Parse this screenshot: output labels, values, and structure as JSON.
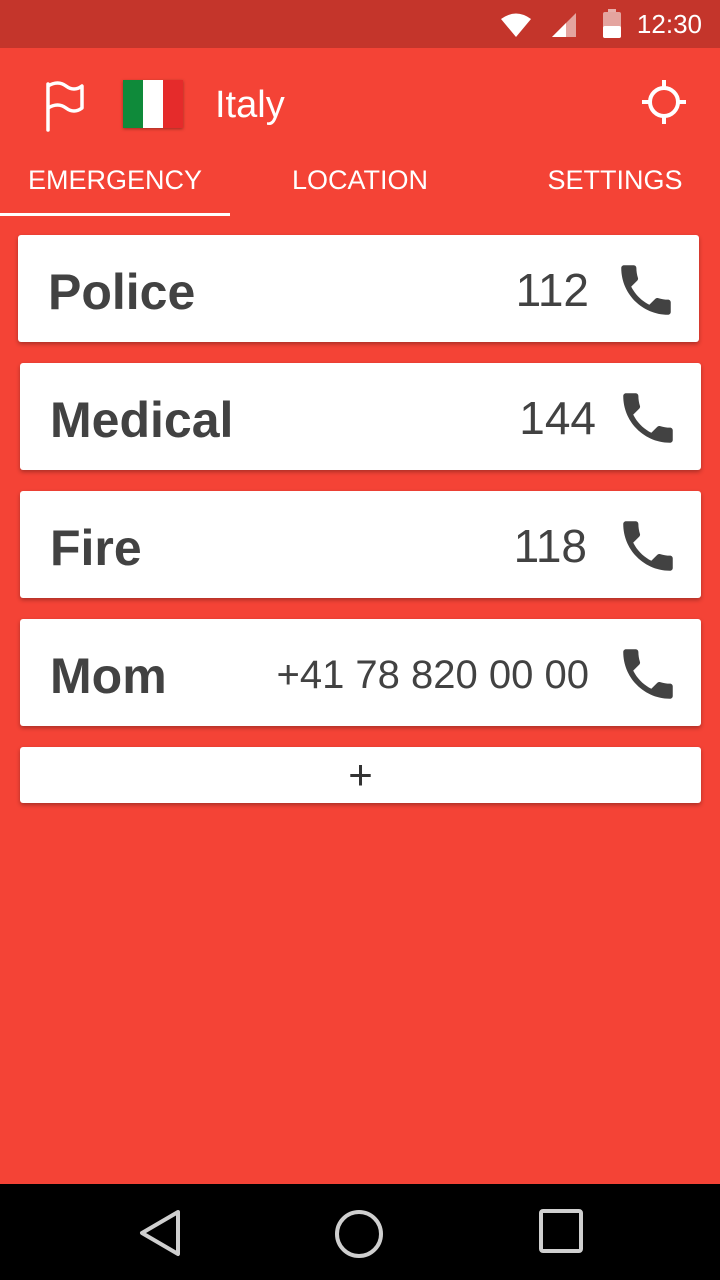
{
  "status_bar": {
    "time": "12:30",
    "icons": [
      "wifi-icon",
      "cell-signal-icon",
      "battery-icon"
    ]
  },
  "app_bar": {
    "country": "Italy",
    "flag_colors": [
      "#0f8a3a",
      "#ffffff",
      "#e52b2b"
    ],
    "icons": [
      "flag-outline-icon",
      "my-location-icon"
    ]
  },
  "tabs": [
    {
      "label": "EMERGENCY",
      "active": true
    },
    {
      "label": "LOCATION",
      "active": false
    },
    {
      "label": "SETTINGS",
      "active": false
    }
  ],
  "contacts": [
    {
      "name": "Police",
      "number": "112"
    },
    {
      "name": "Medical",
      "number": "144"
    },
    {
      "name": "Fire",
      "number": "118"
    },
    {
      "name": "Mom",
      "number": "+41 78 820 00 00"
    }
  ],
  "add_button": {
    "label": "+"
  },
  "colors": {
    "primary": "#f44336",
    "status_bar": "#c4352b",
    "card": "#ffffff",
    "text": "#424242"
  },
  "nav_bar": {
    "icons": [
      "back-icon",
      "home-icon",
      "recents-icon"
    ]
  }
}
